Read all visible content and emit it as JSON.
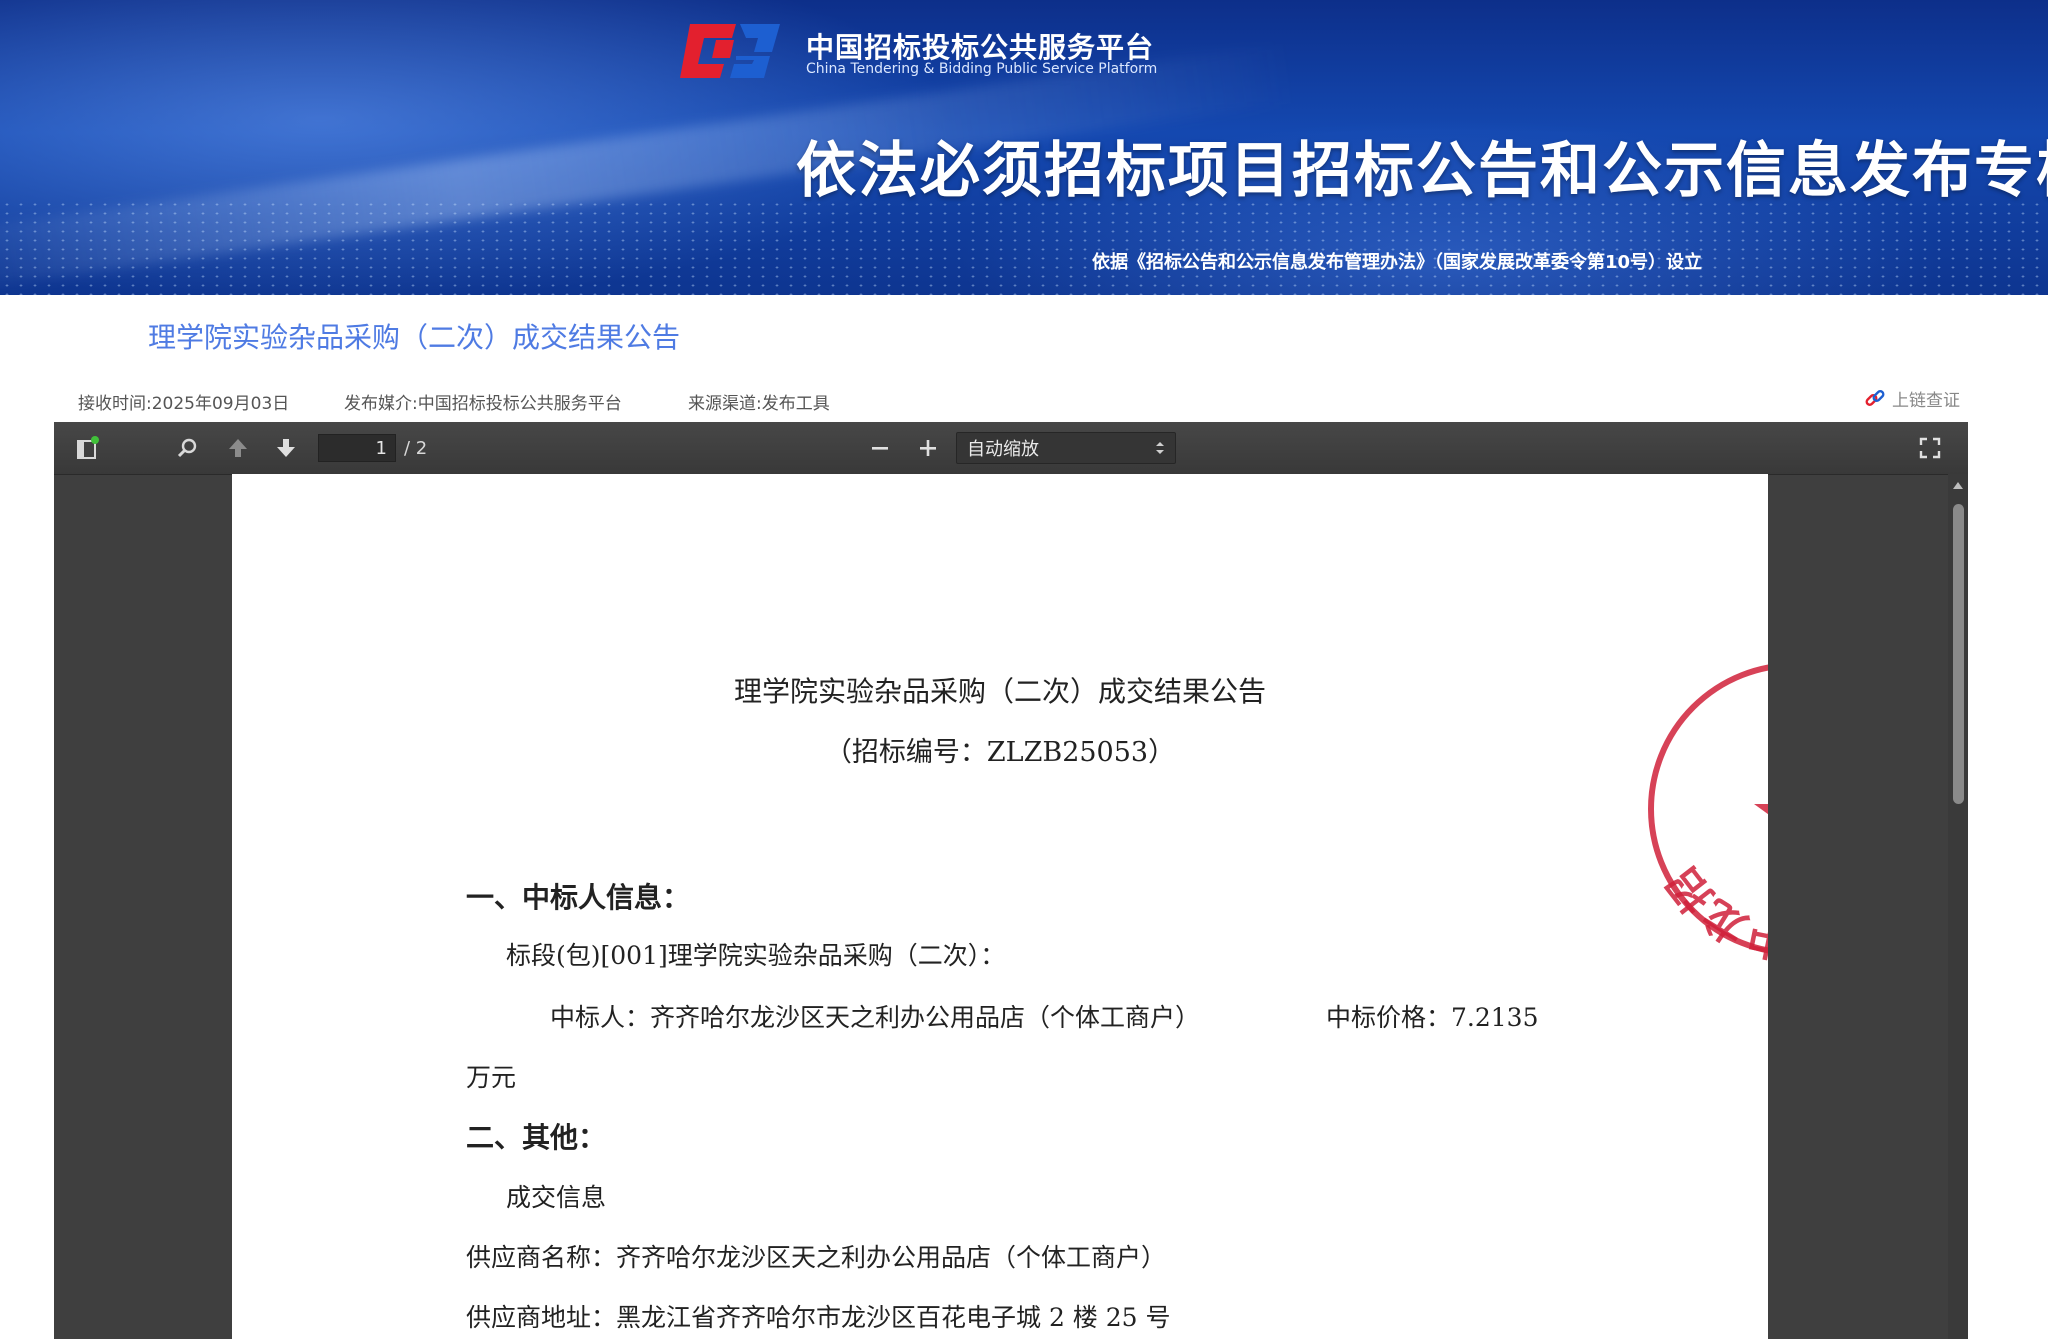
{
  "banner": {
    "platform_name_cn": "中国招标投标公共服务平台",
    "platform_name_en": "China Tendering & Bidding Public Service Platform",
    "title": "依法必须招标项目招标公告和公示信息发布专栏",
    "subtitle": "依据《招标公告和公示信息发布管理办法》（国家发展改革委令第10号）设立"
  },
  "notice": {
    "title": "理学院实验杂品采购（二次）成交结果公告",
    "receive_time": "接收时间:2025年09月03日",
    "media": "发布媒介:中国招标投标公共服务平台",
    "source": "来源渠道:发布工具",
    "chain_check": "上链查证"
  },
  "viewer": {
    "toolbar": {
      "current_page": "1",
      "total_pages": "/ 2",
      "zoom": "自动缩放",
      "icons": [
        "sidebar-toggle-icon",
        "search-icon",
        "previous-page-icon",
        "next-page-icon",
        "zoom-out-icon",
        "zoom-in-icon",
        "fullscreen-icon"
      ]
    },
    "document": {
      "title": "理学院实验杂品采购（二次）成交结果公告",
      "code": "（招标编号：ZLZB25053）",
      "section1": "一、中标人信息：",
      "lot": "标段(包)[001]理学院实验杂品采购（二次）：",
      "winner": "中标人：齐齐哈尔龙沙区天之利办公用品店（个体工商户）",
      "price": "中标价格：7.2135",
      "price_unit": "万元",
      "section2": "二、其他：",
      "deal_info": "成交信息",
      "supplier_name": "供应商名称：齐齐哈尔龙沙区天之利办公用品店（个体工商户）",
      "supplier_address": "供应商地址：黑龙江省齐齐哈尔市龙沙区百花电子城 2 楼 25 号",
      "seal_text": "齐齐哈尔市中龙招"
    }
  },
  "colors": {
    "notice_title": "#4f7be3",
    "seal_red": "#d0213a",
    "viewer_bg": "#3f3f3f",
    "logo_red": "#e3202e",
    "logo_blue": "#1d5fd1"
  }
}
